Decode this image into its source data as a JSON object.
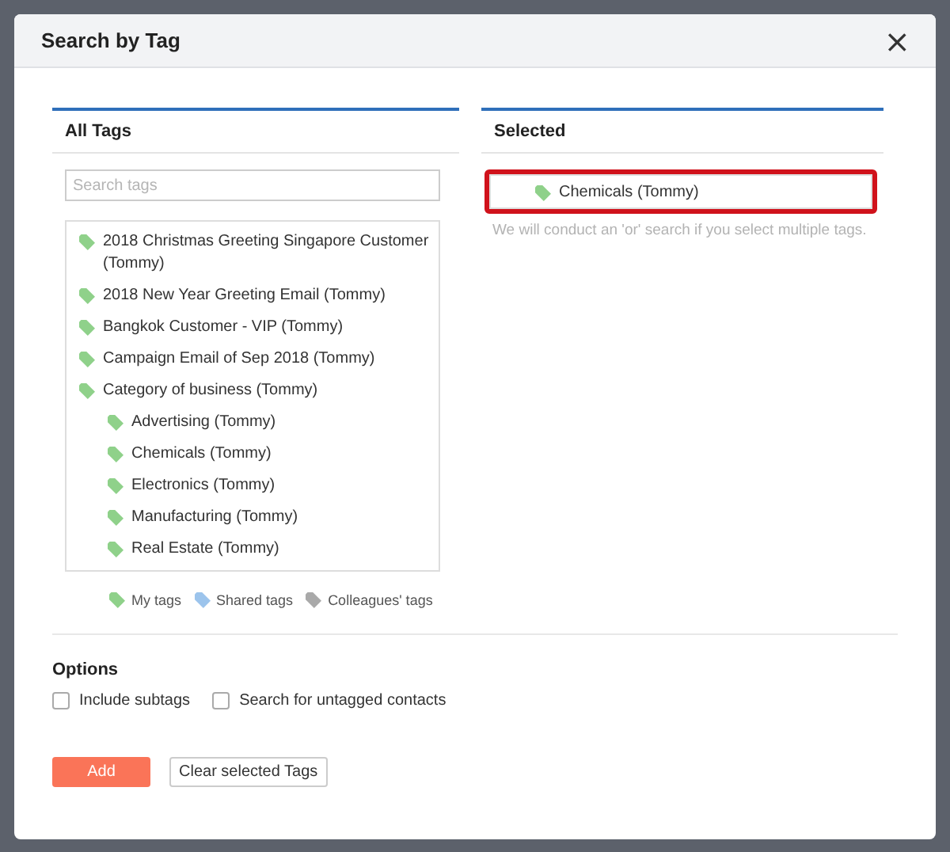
{
  "dialog": {
    "title": "Search by Tag",
    "close": "×"
  },
  "all_tags": {
    "heading": "All Tags",
    "search": {
      "placeholder": "Search tags"
    },
    "tree": [
      {
        "label": "2018 Christmas Greeting Singapore Customer (Tommy)",
        "color": "#8fd18a"
      },
      {
        "label": "2018 New Year Greeting Email (Tommy)",
        "color": "#8fd18a"
      },
      {
        "label": "Bangkok Customer - VIP (Tommy)",
        "color": "#8fd18a"
      },
      {
        "label": "Campaign Email of Sep 2018 (Tommy)",
        "color": "#8fd18a"
      },
      {
        "label": "Category of business (Tommy)",
        "color": "#8fd18a",
        "children": [
          {
            "label": "Advertising (Tommy)",
            "color": "#8fd18a"
          },
          {
            "label": "Chemicals (Tommy)",
            "color": "#8fd18a"
          },
          {
            "label": "Electronics (Tommy)",
            "color": "#8fd18a"
          },
          {
            "label": "Manufacturing (Tommy)",
            "color": "#8fd18a"
          },
          {
            "label": "Real Estate (Tommy)",
            "color": "#8fd18a"
          }
        ]
      }
    ],
    "legend": [
      {
        "label": "My tags",
        "color": "#8fd18a"
      },
      {
        "label": "Shared tags",
        "color": "#9cc4ec"
      },
      {
        "label": "Colleagues' tags",
        "color": "#a9a9a9"
      }
    ]
  },
  "selected_tags": {
    "heading": "Selected",
    "items": [
      {
        "label": "Chemicals (Tommy)",
        "color": "#8fd18a",
        "highlighted": true
      }
    ],
    "hint": "We will conduct an 'or' search if you select multiple tags."
  },
  "options": {
    "heading": "Options",
    "checkboxes": [
      {
        "label": "Include subtags",
        "checked": false
      },
      {
        "label": "Search for untagged contacts",
        "checked": false
      }
    ]
  },
  "buttons": [
    {
      "label": "Add",
      "kind": "primary"
    },
    {
      "label": "Clear selected Tags",
      "kind": "secondary"
    }
  ]
}
